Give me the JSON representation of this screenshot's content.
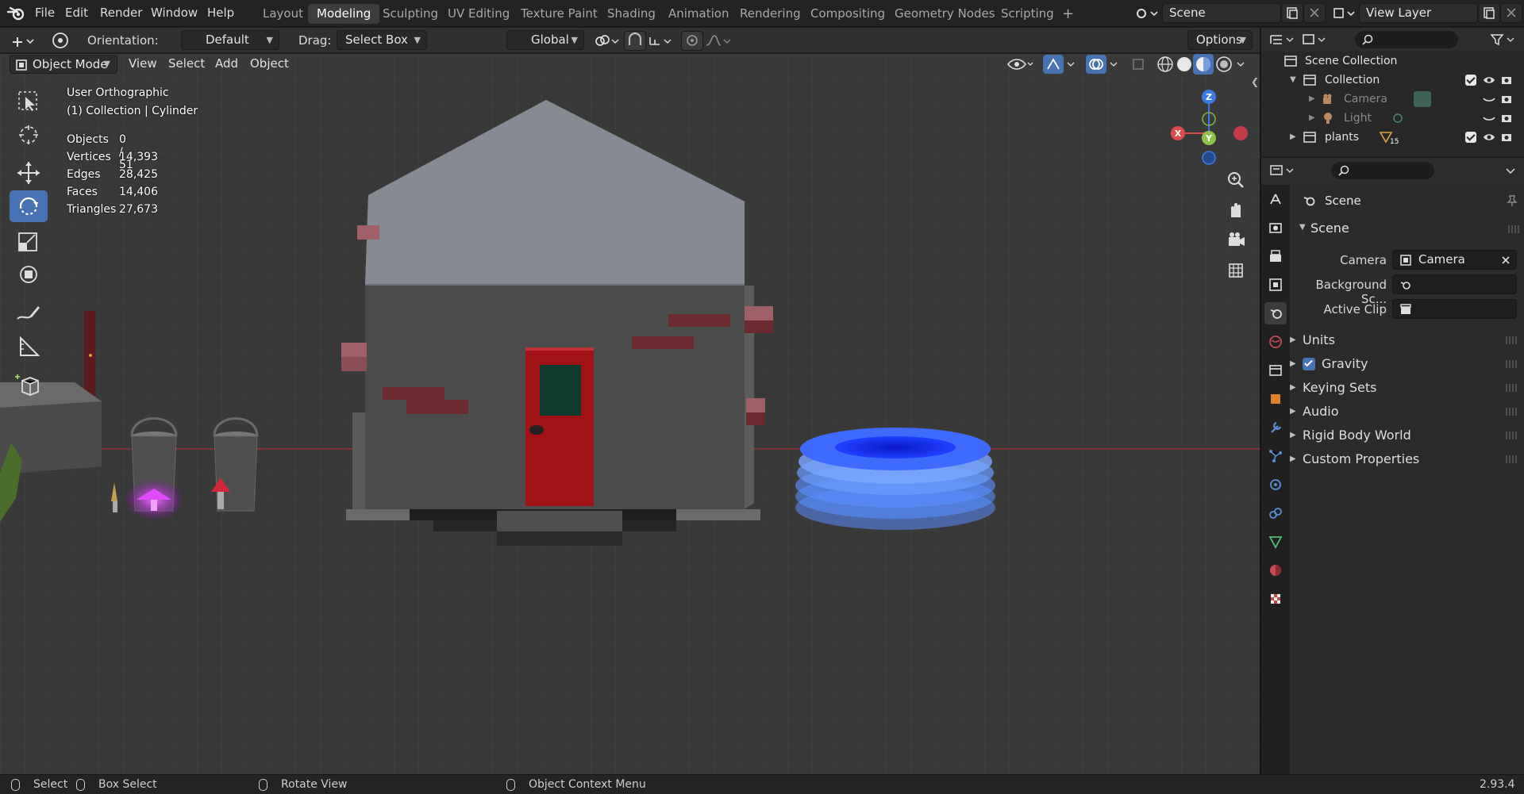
{
  "menu": [
    "File",
    "Edit",
    "Render",
    "Window",
    "Help"
  ],
  "workspaces": [
    {
      "label": "Layout",
      "active": false
    },
    {
      "label": "Modeling",
      "active": true
    },
    {
      "label": "Sculpting",
      "active": false
    },
    {
      "label": "UV Editing",
      "active": false
    },
    {
      "label": "Texture Paint",
      "active": false
    },
    {
      "label": "Shading",
      "active": false
    },
    {
      "label": "Animation",
      "active": false
    },
    {
      "label": "Rendering",
      "active": false
    },
    {
      "label": "Compositing",
      "active": false
    },
    {
      "label": "Geometry Nodes",
      "active": false
    },
    {
      "label": "Scripting",
      "active": false
    }
  ],
  "top_right": {
    "scene_name": "Scene",
    "view_layer": "View Layer",
    "add_workspace": "+"
  },
  "tool_header": {
    "orientation_label": "Orientation:",
    "orientation_value": "Default",
    "drag_label": "Drag:",
    "drag_value": "Select Box",
    "transform_orientation": "Global",
    "options_label": "Options"
  },
  "viewport_header": {
    "mode": "Object Mode",
    "menus": [
      "View",
      "Select",
      "Add",
      "Object"
    ]
  },
  "viewport_overlay": {
    "view_name": "User Orthographic",
    "context": "(1) Collection | Cylinder",
    "stats": [
      {
        "label": "Objects",
        "value": "0 / 51"
      },
      {
        "label": "Vertices",
        "value": "14,393"
      },
      {
        "label": "Edges",
        "value": "28,425"
      },
      {
        "label": "Faces",
        "value": "14,406"
      },
      {
        "label": "Triangles",
        "value": "27,673"
      }
    ]
  },
  "gizmo": {
    "x": "X",
    "y": "Y",
    "z": "Z"
  },
  "outliner": {
    "root": "Scene Collection",
    "rows": [
      {
        "label": "Collection"
      },
      {
        "label": "Camera"
      },
      {
        "label": "Light"
      },
      {
        "label": "plants",
        "badge": "15"
      }
    ]
  },
  "properties": {
    "context_title": "Scene",
    "section_title": "Scene",
    "fields": [
      {
        "label": "Camera",
        "value": "Camera"
      },
      {
        "label": "Background Sc...",
        "value": ""
      },
      {
        "label": "Active Clip",
        "value": ""
      }
    ],
    "panels": [
      {
        "label": "Units",
        "checkbox": false
      },
      {
        "label": "Gravity",
        "checkbox": true
      },
      {
        "label": "Keying Sets",
        "checkbox": false
      },
      {
        "label": "Audio",
        "checkbox": false
      },
      {
        "label": "Rigid Body World",
        "checkbox": false
      },
      {
        "label": "Custom Properties",
        "checkbox": false
      }
    ]
  },
  "statusbar": {
    "select": "Select",
    "box_select": "Box Select",
    "rotate_view": "Rotate View",
    "context_menu": "Object Context Menu",
    "version": "2.93.4"
  },
  "colors": {
    "accent": "#4772b3",
    "door": "#a01216",
    "water": "#3d7bff",
    "glow": "#d23cff"
  }
}
